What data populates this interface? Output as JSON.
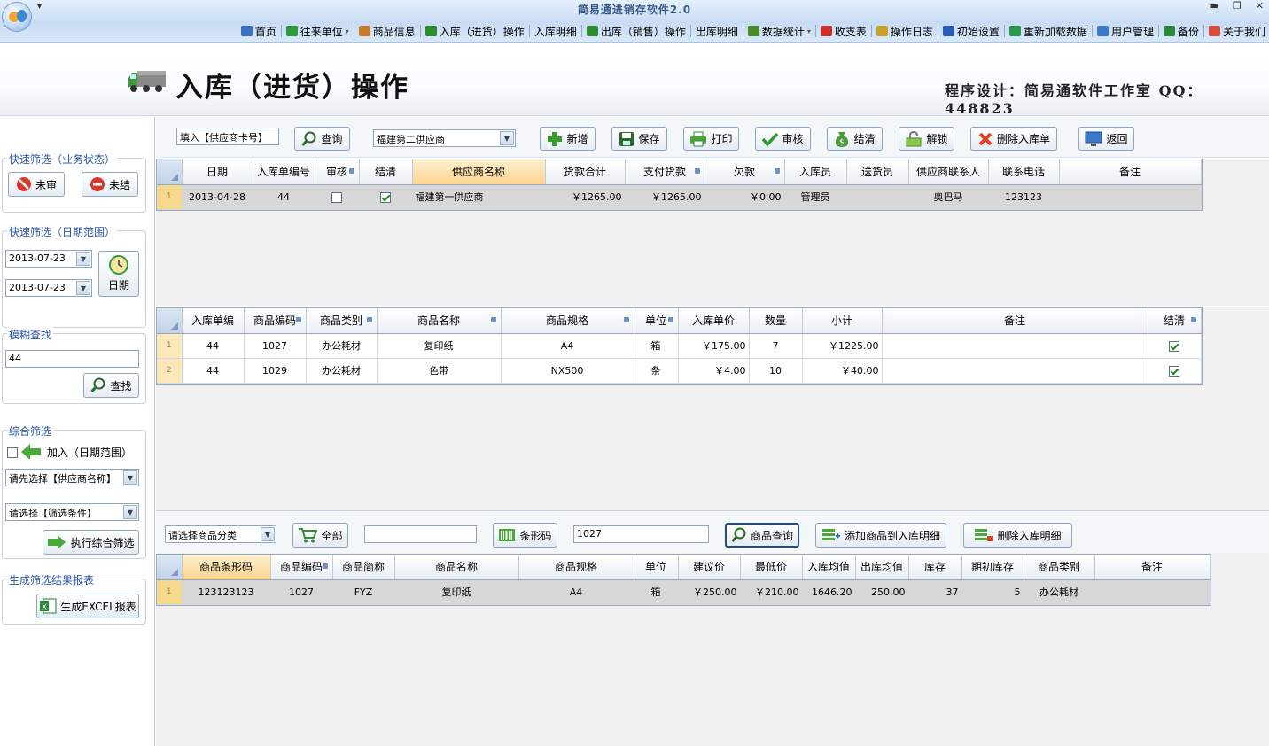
{
  "window": {
    "title": "简易通进销存软件2.0",
    "qat": "▾",
    "controls": [
      "▬",
      "❐",
      "✕"
    ]
  },
  "menu": {
    "items": [
      {
        "label": "首页",
        "icon": "monitor-icon",
        "color": "#3a6fc2"
      },
      {
        "label": "往来单位",
        "icon": "contacts-icon",
        "color": "#2f9a3a",
        "dropdown": "▾"
      },
      {
        "label": "商品信息",
        "icon": "document-icon",
        "color": "#c87a2a"
      },
      {
        "label": "入库（进货）操作",
        "icon": "arrow-down-icon",
        "color": "#2e8b2e"
      },
      {
        "label": "入库明细",
        "icon": "",
        "color": ""
      },
      {
        "label": "出库（销售）操作",
        "icon": "arrow-up-icon",
        "color": "#2e8b2e"
      },
      {
        "label": "出库明细",
        "icon": "",
        "color": ""
      },
      {
        "label": "数据统计",
        "icon": "chart-icon",
        "color": "#4a8a2a",
        "dropdown": "▾"
      },
      {
        "label": "收支表",
        "icon": "bar-chart-icon",
        "color": "#c8322a"
      },
      {
        "label": "操作日志",
        "icon": "clock-icon",
        "color": "#c8a02a"
      },
      {
        "label": "初始设置",
        "icon": "globe-icon",
        "color": "#2a5ab8"
      },
      {
        "label": "重新加载数据",
        "icon": "refresh-icon",
        "color": "#2a9a4a"
      },
      {
        "label": "用户管理",
        "icon": "users-icon",
        "color": "#3a7ac8"
      },
      {
        "label": "备份",
        "icon": "save-icon",
        "color": "#2a8a3a"
      },
      {
        "label": "关于我们",
        "icon": "people-icon",
        "color": "#d84a3a"
      }
    ]
  },
  "header": {
    "title": "入库（进货）操作",
    "credit": "程序设计：简易通软件工作室 QQ：448823"
  },
  "sidebar": {
    "status": {
      "legend": "快速筛选（业务状态）",
      "unapproved": "未审",
      "unsettled": "未结"
    },
    "daterange": {
      "legend": "快速筛选（日期范围）",
      "from": "2013-07-23",
      "to": "2013-07-23",
      "button": "日期"
    },
    "fuzzy": {
      "legend": "模糊查找",
      "value": "44",
      "button": "查找"
    },
    "combined": {
      "legend": "综合筛选",
      "add_label": "加入（日期范围）",
      "supplier_select": "请先选择【供应商名称】",
      "condition_select": "请选择【筛选条件】",
      "button": "执行综合筛选"
    },
    "report": {
      "legend": "生成筛选结果报表",
      "button": "生成EXCEL报表"
    }
  },
  "toolbar": {
    "card_input": "填入【供应商卡号】",
    "query": "查询",
    "supplier_select": "福建第二供应商",
    "add": "新增",
    "save": "保存",
    "print": "打印",
    "approve": "审核",
    "settle": "结清",
    "unlock": "解锁",
    "delete": "删除入库单",
    "back": "返回"
  },
  "orders": {
    "columns": [
      "日期",
      "入库单编号",
      "审核",
      "结清",
      "供应商名称",
      "货款合计",
      "支付货款",
      "欠款",
      "入库员",
      "送货员",
      "供应商联系人",
      "联系电话",
      "备注"
    ],
    "rows": [
      {
        "rn": "1",
        "date": "2013-04-28",
        "no": "44",
        "approved": false,
        "settled": true,
        "supplier": "福建第一供应商",
        "total": "￥1265.00",
        "paid": "￥1265.00",
        "owed": "￥0.00",
        "clerk": "管理员",
        "courier": "",
        "contact": "奥巴马",
        "phone": "123123",
        "remark": ""
      }
    ]
  },
  "details": {
    "columns": [
      "入库单编",
      "商品编码",
      "商品类别",
      "商品名称",
      "商品规格",
      "单位",
      "入库单价",
      "数量",
      "小计",
      "备注",
      "结清"
    ],
    "rows": [
      {
        "rn": "1",
        "order_no": "44",
        "code": "1027",
        "category": "办公耗材",
        "name": "复印纸",
        "spec": "A4",
        "unit": "箱",
        "price": "￥175.00",
        "qty": "7",
        "subtotal": "￥1225.00",
        "remark": "",
        "settled": true
      },
      {
        "rn": "2",
        "order_no": "44",
        "code": "1029",
        "category": "办公耗材",
        "name": "色带",
        "spec": "NX500",
        "unit": "条",
        "price": "￥4.00",
        "qty": "10",
        "subtotal": "￥40.00",
        "remark": "",
        "settled": true
      }
    ]
  },
  "product_bar": {
    "category_select": "请选择商品分类",
    "all": "全部",
    "barcode_input": "",
    "barcode_button": "条形码",
    "code_input": "1027",
    "product_query": "商品查询",
    "add_to_detail": "添加商品到入库明细",
    "delete_detail": "删除入库明细"
  },
  "products": {
    "columns": [
      "商品条形码",
      "商品编码",
      "商品简称",
      "商品名称",
      "商品规格",
      "单位",
      "建议价",
      "最低价",
      "入库均值",
      "出库均值",
      "库存",
      "期初库存",
      "商品类别",
      "备注"
    ],
    "rows": [
      {
        "rn": "1",
        "barcode": "123123123",
        "code": "1027",
        "short": "FYZ",
        "name": "复印纸",
        "spec": "A4",
        "unit": "箱",
        "suggest": "￥250.00",
        "min": "￥210.00",
        "in_avg": "1646.20",
        "out_avg": "250.00",
        "stock": "37",
        "init_stock": "5",
        "category": "办公耗材",
        "remark": ""
      }
    ]
  }
}
